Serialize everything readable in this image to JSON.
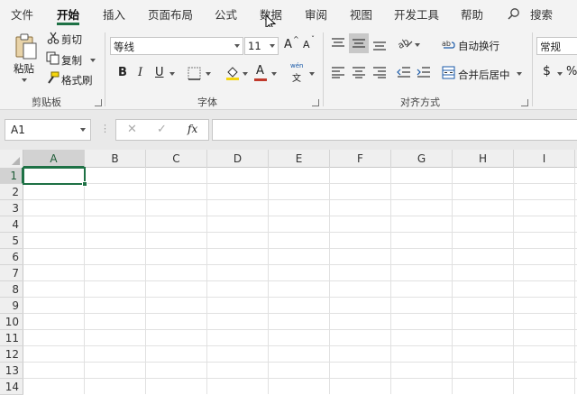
{
  "menu": {
    "tabs": [
      "文件",
      "开始",
      "插入",
      "页面布局",
      "公式",
      "数据",
      "审阅",
      "视图",
      "开发工具",
      "帮助"
    ],
    "active_tab": "开始",
    "search_label": "搜索"
  },
  "ribbon": {
    "clipboard": {
      "paste": "粘贴",
      "cut": "剪切",
      "copy": "复制",
      "format_painter": "格式刷",
      "group_label": "剪贴板"
    },
    "font": {
      "font_name": "等线",
      "font_size": "11",
      "increase_font": "A",
      "decrease_font": "A",
      "bold": "B",
      "italic": "I",
      "underline": "U",
      "phonetic": "wén",
      "phonetic_char": "文",
      "group_label": "字体"
    },
    "alignment": {
      "wrap_text": "自动换行",
      "merge_center": "合并后居中",
      "group_label": "对齐方式"
    },
    "number": {
      "format": "常规",
      "currency": "$"
    }
  },
  "formula_bar": {
    "name_box": "A1",
    "fx": "fx",
    "value": ""
  },
  "sheet": {
    "columns": [
      "A",
      "B",
      "C",
      "D",
      "E",
      "F",
      "G",
      "H",
      "I"
    ],
    "rows": [
      "1",
      "2",
      "3",
      "4",
      "5",
      "6",
      "7",
      "8",
      "9",
      "10",
      "11",
      "12",
      "13",
      "14"
    ],
    "selected_cell": "A1"
  },
  "colors": {
    "accent": "#1e7145",
    "font_color": "#c0392b",
    "highlight": "#f5d50b"
  }
}
